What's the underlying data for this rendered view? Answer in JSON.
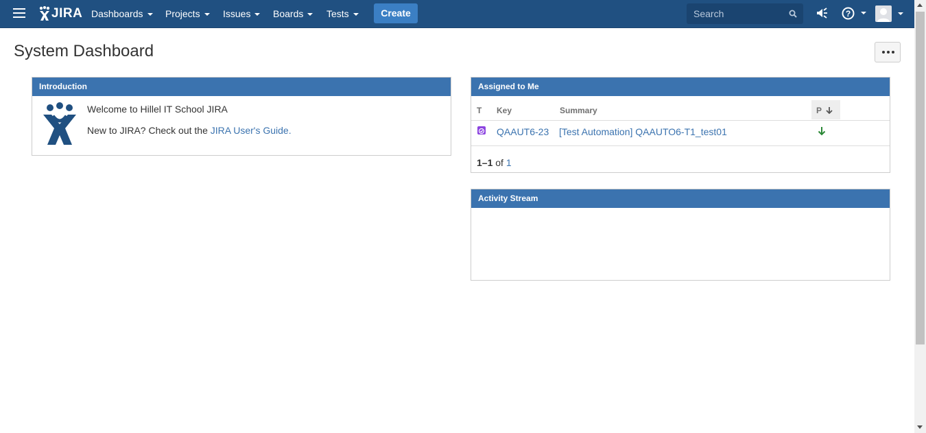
{
  "header": {
    "logo_text": "JIRA",
    "nav": [
      {
        "label": "Dashboards"
      },
      {
        "label": "Projects"
      },
      {
        "label": "Issues"
      },
      {
        "label": "Boards"
      },
      {
        "label": "Tests"
      }
    ],
    "create_label": "Create",
    "search_placeholder": "Search",
    "icons": [
      "menu-icon",
      "search-icon",
      "megaphone-icon",
      "help-icon",
      "avatar-icon"
    ]
  },
  "page": {
    "title": "System Dashboard"
  },
  "intro_gadget": {
    "title": "Introduction",
    "welcome": "Welcome to Hillel IT School JIRA",
    "new_prefix": "New to JIRA? Check out the ",
    "guide_link": "JIRA User's Guide",
    "new_suffix": "."
  },
  "assigned_gadget": {
    "title": "Assigned to Me",
    "columns": [
      "T",
      "Key",
      "Summary",
      "P"
    ],
    "rows": [
      {
        "key": "QAAUT6-23",
        "summary": "[Test Automation] QAAUTO6-T1_test01",
        "priority": "Low"
      }
    ],
    "count_range": "1–1",
    "count_of": "of",
    "count_total": "1"
  },
  "activity_gadget": {
    "title": "Activity Stream"
  },
  "colors": {
    "header_bg": "#205081",
    "gadget_header": "#3b73af",
    "link": "#3b73af",
    "priority_low": "#2a8735"
  }
}
